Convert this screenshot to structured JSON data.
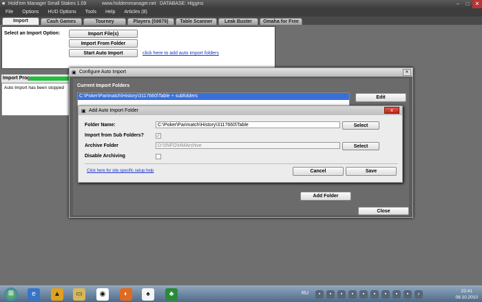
{
  "window": {
    "app_title": "Hold'em Manager Small Stakes 1.09",
    "site": "www.holdemmanager.net",
    "database": "DATABASE: Higgins"
  },
  "menu": [
    "File",
    "Options",
    "HUD Options",
    "Tools",
    "Help",
    "Articles (8)"
  ],
  "tabs": [
    "Import",
    "Cash Games",
    "Tourney",
    "Players (59879)",
    "Table Scanner",
    "Leak Buster",
    "Omaha for Free"
  ],
  "import_panel": {
    "label": "Select an Import Option:",
    "import_files": "Import File(s)",
    "import_folder": "Import From Folder",
    "start_auto": "Start Auto Import",
    "auto_link": "click here to add auto import folders",
    "progress_label": "Import Progress:",
    "log_text": "Auto Import has been stopped"
  },
  "configure_dialog": {
    "title": "Configure Auto Import",
    "current_folders_label": "Current Import Folders",
    "folders": [
      "C:\\Poker\\Parimatch\\History\\3117660\\Table + subfolders"
    ],
    "edit_button": "Edit",
    "add_folder_button": "Add Folder",
    "close_button": "Close"
  },
  "add_dialog": {
    "title": "Add Auto Import Folder",
    "close_glyph": "x",
    "folder_name_label": "Folder Name:",
    "folder_name_value": "C:\\Poker\\Parimatch\\History\\3117660\\Table",
    "select_button": "Select",
    "subfolders_label": "Import from Sub Folders?",
    "subfolders_checked": true,
    "archive_label": "Archive Folder",
    "archive_value": "D:\\!INFO\\HMArchive",
    "disable_archiving_label": "Disable Archiving",
    "disable_archiving_checked": false,
    "help_link": "Click here for site specific setup help",
    "cancel_button": "Cancel",
    "save_button": "Save"
  },
  "taskbar": {
    "language": "RU",
    "time": "22:41",
    "date": "08.10.2010"
  },
  "colors": {
    "progress": "#1fbf3a",
    "selection": "#3a6fd8",
    "link": "#1a33cc"
  }
}
